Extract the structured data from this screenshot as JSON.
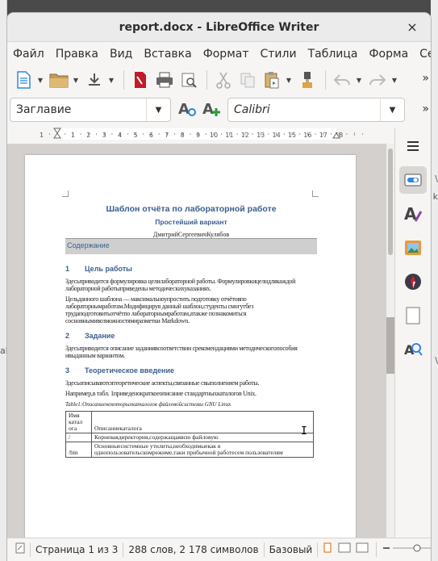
{
  "background_app": {
    "fragment_left": "ak",
    "fragment_right_1": "\\",
    "fragment_right_2": "k",
    "fragment_right_3": "\\"
  },
  "window": {
    "title": "report.docx - LibreOffice Writer",
    "close_glyph": "×"
  },
  "menu": [
    "Файл",
    "Правка",
    "Вид",
    "Вставка",
    "Формат",
    "Стили",
    "Таблица",
    "Форма",
    "Сє"
  ],
  "toolbar": {
    "icons": [
      "new-document-icon",
      "open-folder-icon",
      "save-icon",
      "export-pdf-icon",
      "print-icon",
      "print-preview-icon",
      "cut-icon",
      "copy-icon",
      "paste-icon",
      "clone-formatting-icon",
      "undo-icon",
      "redo-icon"
    ],
    "more_glyph": "»"
  },
  "formatting": {
    "paragraph_style": "Заглавие",
    "font_name": "Calibri",
    "more_glyph": "»"
  },
  "ruler": {
    "labels": [
      "1",
      "1",
      "2",
      "3",
      "4",
      "5",
      "6",
      "7",
      "8",
      "9",
      "10",
      "11",
      "12",
      "13",
      "14",
      "15",
      "16",
      "17",
      "18"
    ]
  },
  "document": {
    "title": "Шаблон отчёта по лабораторной работе",
    "subtitle": "Простейший вариант",
    "author": "ДмитрийСергеевичКулябов",
    "toc_title": "Содержание",
    "sections": [
      {
        "number": "1",
        "title": "Цель работы",
        "paragraphs": [
          "Здесьприводится формулировка целилабораторной работы. Формулировкицелидлякаждой лабораторной работыприведены методическихуказаниях.",
          "Цельданного шаблона — максимальноупростить подготовку отчётовпо лабораторнымработам.Модифицируя данный шаблон,студенты смогутбез трудаподготовитьотчётпо лабораторнымработам,атакже познакомиться сосновнымивозможностямиразметки Markdown."
        ]
      },
      {
        "number": "2",
        "title": "Задание",
        "paragraphs": [
          "Здесьприводится описание заданиявсоответствии срекомендациями методическогопособия ивыданным вариантом."
        ]
      },
      {
        "number": "3",
        "title": "Теоретическое введение",
        "paragraphs": [
          "Здесьописываютсятеоретические аспекты,связанные свыполнением работы.",
          "Например,в табл. 1приведенократкоеописание стандартныхкаталогов Unix."
        ]
      }
    ],
    "table_caption": "Table1:Описаниенекоторыхкаталогов файловойсистемы GNU Linux",
    "table": {
      "header": [
        "Имя катал ога",
        "Описаниекаталога"
      ],
      "rows": [
        [
          "/",
          "Корневаядиректория,содержащаявсю файловую"
        ],
        [
          "/bin",
          "Основныесистемные утилиты,необходимыекак в однопользовательскомрежиме,таки прибычной работесем пользователям"
        ]
      ]
    }
  },
  "sidebar": {
    "icons": [
      "hamburger-menu-icon",
      "properties-icon",
      "styles-icon",
      "gallery-icon",
      "navigator-icon",
      "page-icon",
      "style-inspector-icon"
    ]
  },
  "status": {
    "page": "Страница 1 из 3",
    "words": "288 слов, 2 178 символов",
    "style": "Базовый"
  },
  "colors": {
    "heading_blue": "#3a5f8f",
    "accent": "#3584e4"
  }
}
